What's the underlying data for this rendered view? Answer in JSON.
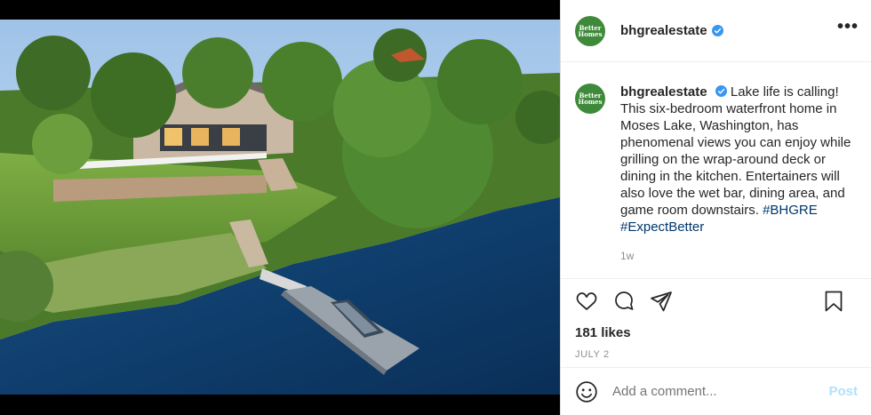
{
  "post": {
    "username": "bhgrealestate",
    "avatar_text": [
      "Better",
      "Homes"
    ],
    "caption_text": "Lake life is calling! This six-bedroom waterfront home in Moses Lake, Washington, has phenomenal views you can enjoy while grilling on the wrap-around deck or dining in the kitchen. Entertainers will also love the wet bar, dining area, and game room downstairs.",
    "hashtags": [
      "#BHGRE",
      "#ExpectBetter"
    ],
    "time_ago": "1w",
    "likes": "181 likes",
    "date": "JULY 2",
    "more_label": "•••"
  },
  "comment": {
    "placeholder": "Add a comment...",
    "post_label": "Post"
  },
  "colors": {
    "verified": "#3897f0",
    "avatar_bg": "#3f8a3a",
    "hashtag": "#00376b",
    "post_disabled": "#b2dffc"
  },
  "icons": [
    "heart-icon",
    "comment-icon",
    "share-icon",
    "bookmark-icon",
    "emoji-icon",
    "verified-badge-icon",
    "more-options-icon"
  ]
}
